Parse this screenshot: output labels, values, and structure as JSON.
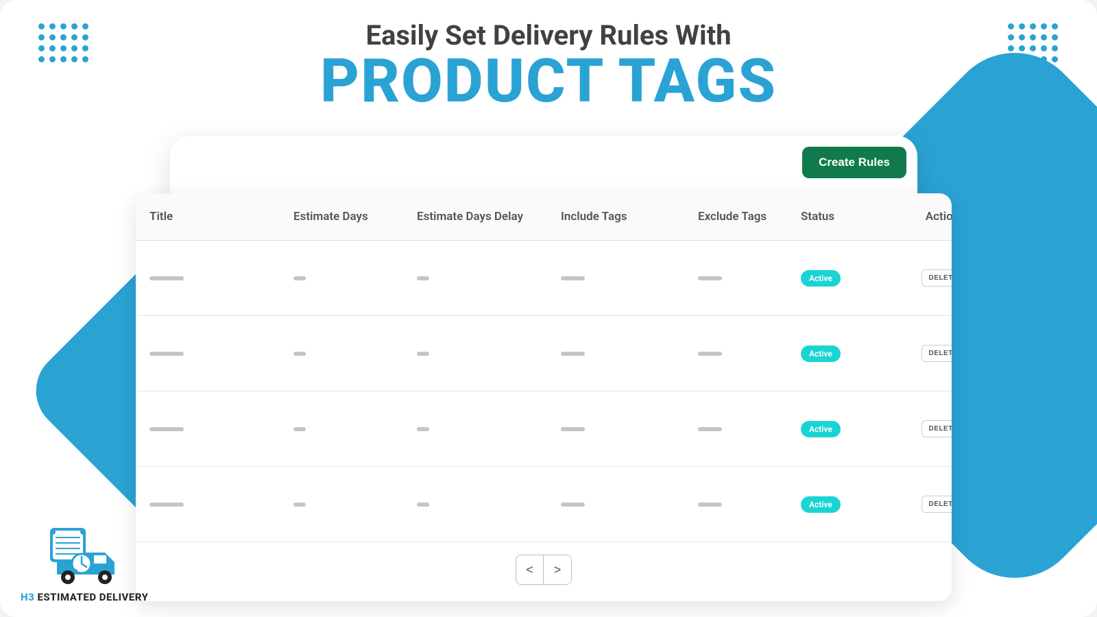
{
  "heading": {
    "line1": "Easily Set Delivery Rules With",
    "line2": "PRODUCT TAGS"
  },
  "buttons": {
    "create": "Create Rules"
  },
  "table": {
    "headers": [
      "Title",
      "Estimate Days",
      "Estimate Days Delay",
      "Include Tags",
      "Exclude Tags",
      "Status",
      "Actions"
    ],
    "rows": [
      {
        "status": "Active",
        "delete": "DELETE"
      },
      {
        "status": "Active",
        "delete": "DELETE"
      },
      {
        "status": "Active",
        "delete": "DELETE"
      },
      {
        "status": "Active",
        "delete": "DELETE"
      }
    ]
  },
  "pager": {
    "prev": "<",
    "next": ">"
  },
  "logo": {
    "h3": "H3",
    "rest": " ESTIMATED DELIVERY"
  },
  "colors": {
    "accent": "#2aa3d4",
    "success": "#117a4d",
    "badge": "#1ad4d4"
  }
}
